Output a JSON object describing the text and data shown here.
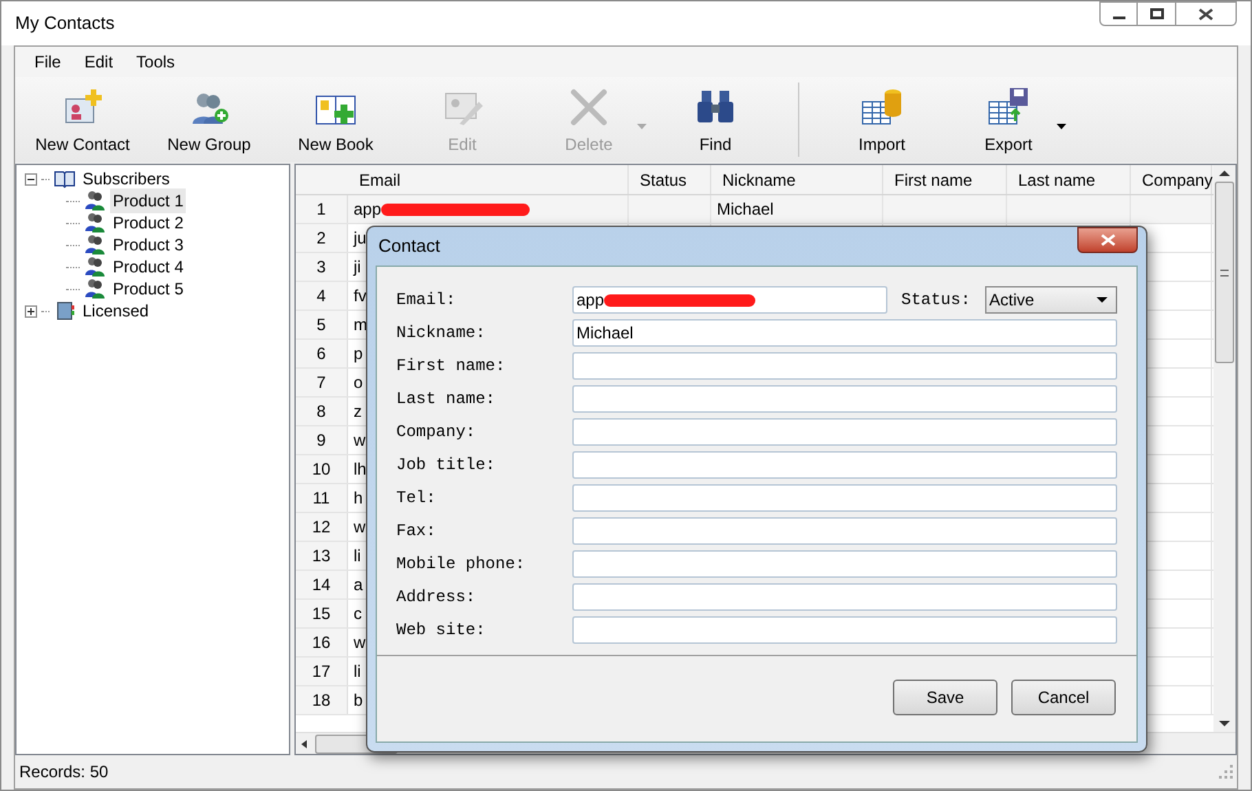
{
  "window": {
    "title": "My Contacts"
  },
  "menu": [
    "File",
    "Edit",
    "Tools"
  ],
  "toolbar": [
    {
      "kind": "new-contact",
      "label": "New Contact",
      "disabled": false,
      "dropdown": false
    },
    {
      "kind": "new-group",
      "label": "New Group",
      "disabled": false,
      "dropdown": false
    },
    {
      "kind": "new-book",
      "label": "New Book",
      "disabled": false,
      "dropdown": false
    },
    {
      "kind": "edit",
      "label": "Edit",
      "disabled": true,
      "dropdown": false
    },
    {
      "kind": "delete",
      "label": "Delete",
      "disabled": true,
      "dropdown": true
    },
    {
      "kind": "find",
      "label": "Find",
      "disabled": false,
      "dropdown": false
    },
    {
      "kind": "separator"
    },
    {
      "kind": "import",
      "label": "Import",
      "disabled": false,
      "dropdown": false
    },
    {
      "kind": "export",
      "label": "Export",
      "disabled": false,
      "dropdown": true
    }
  ],
  "tree": [
    {
      "label": "Subscribers",
      "kind": "book",
      "expanded": true,
      "selected": false,
      "children": [
        {
          "label": "Product 1",
          "kind": "group",
          "selected": true
        },
        {
          "label": "Product 2",
          "kind": "group",
          "selected": false
        },
        {
          "label": "Product 3",
          "kind": "group",
          "selected": false
        },
        {
          "label": "Product 4",
          "kind": "group",
          "selected": false
        },
        {
          "label": "Product 5",
          "kind": "group",
          "selected": false
        }
      ]
    },
    {
      "label": "Licensed",
      "kind": "licensed",
      "expanded": false,
      "selected": false
    }
  ],
  "table": {
    "columns": [
      "Email",
      "Status",
      "Nickname",
      "First name",
      "Last name",
      "Company"
    ],
    "rows": [
      {
        "number": "1",
        "email": "app",
        "redacted": true,
        "nickname": "Michael"
      },
      {
        "number": "2",
        "email": "ju"
      },
      {
        "number": "3",
        "email": "ji"
      },
      {
        "number": "4",
        "email": "fv"
      },
      {
        "number": "5",
        "email": "m"
      },
      {
        "number": "6",
        "email": "p"
      },
      {
        "number": "7",
        "email": "o"
      },
      {
        "number": "8",
        "email": "z"
      },
      {
        "number": "9",
        "email": "w"
      },
      {
        "number": "10",
        "email": "lh"
      },
      {
        "number": "11",
        "email": "h"
      },
      {
        "number": "12",
        "email": "w"
      },
      {
        "number": "13",
        "email": "li"
      },
      {
        "number": "14",
        "email": "a"
      },
      {
        "number": "15",
        "email": "c"
      },
      {
        "number": "16",
        "email": "w"
      },
      {
        "number": "17",
        "email": "li"
      },
      {
        "number": "18",
        "email": "b"
      }
    ]
  },
  "dialog": {
    "title": "Contact",
    "fields": [
      {
        "label": "Email:",
        "value": "app",
        "redacted": true
      },
      {
        "label": "Nickname:",
        "value": "Michael"
      },
      {
        "label": "First name:"
      },
      {
        "label": "Last name:"
      },
      {
        "label": "Company:"
      },
      {
        "label": "Job title:"
      },
      {
        "label": "Tel:"
      },
      {
        "label": "Fax:"
      },
      {
        "label": "Mobile phone:"
      },
      {
        "label": "Address:"
      },
      {
        "label": "Web site:"
      }
    ],
    "status": {
      "label": "Status:",
      "value": "Active"
    },
    "buttons": [
      "Save",
      "Cancel"
    ]
  },
  "status_bar": "Records: 50"
}
